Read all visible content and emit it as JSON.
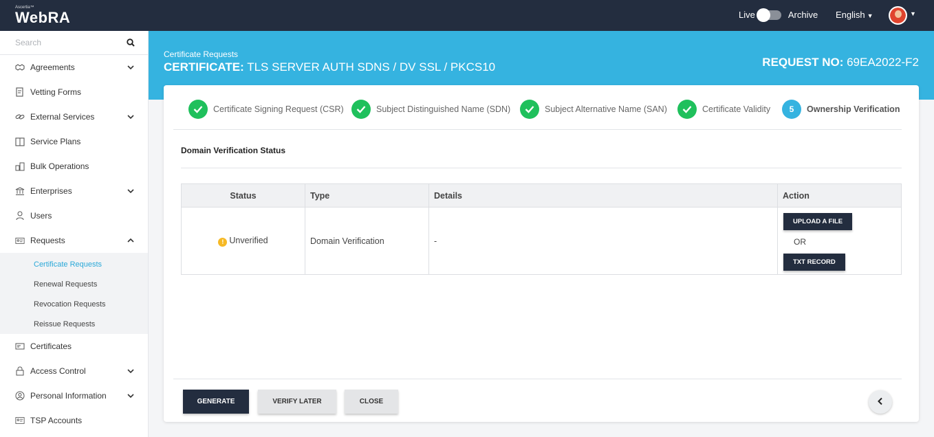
{
  "topbar": {
    "logo_small": "Ascertia™",
    "logo_main": "WebRA",
    "mode_live": "Live",
    "mode_archive": "Archive",
    "language": "English"
  },
  "sidebar": {
    "search_placeholder": "Search",
    "items": [
      {
        "label": "Agreements",
        "icon": "agreement-icon",
        "expandable": true
      },
      {
        "label": "Vetting Forms",
        "icon": "vetting-form-icon",
        "expandable": false
      },
      {
        "label": "External Services",
        "icon": "link-icon",
        "expandable": true
      },
      {
        "label": "Service Plans",
        "icon": "service-plan-icon",
        "expandable": false
      },
      {
        "label": "Bulk Operations",
        "icon": "bulk-icon",
        "expandable": false
      },
      {
        "label": "Enterprises",
        "icon": "bank-icon",
        "expandable": true
      },
      {
        "label": "Users",
        "icon": "user-icon",
        "expandable": false
      },
      {
        "label": "Requests",
        "icon": "requests-icon",
        "expandable": true,
        "expanded": true
      },
      {
        "label": "Certificates",
        "icon": "certificate-icon",
        "expandable": false
      },
      {
        "label": "Access Control",
        "icon": "lock-icon",
        "expandable": true
      },
      {
        "label": "Personal Information",
        "icon": "person-icon",
        "expandable": true
      },
      {
        "label": "TSP Accounts",
        "icon": "tsp-icon",
        "expandable": false
      }
    ],
    "requests_submenu": [
      {
        "label": "Certificate Requests",
        "active": true
      },
      {
        "label": "Renewal Requests",
        "active": false
      },
      {
        "label": "Revocation Requests",
        "active": false
      },
      {
        "label": "Reissue Requests",
        "active": false
      }
    ]
  },
  "header": {
    "breadcrumb": "Certificate Requests",
    "title_prefix": "CERTIFICATE:",
    "title_value": "TLS SERVER AUTH SDNS / DV SSL / PKCS10",
    "request_no_label": "REQUEST NO:",
    "request_no_value": "69EA2022-F2"
  },
  "steps": [
    {
      "label": "Certificate Signing Request (CSR)",
      "status": "done"
    },
    {
      "label": "Subject Distinguished Name (SDN)",
      "status": "done"
    },
    {
      "label": "Subject Alternative Name (SAN)",
      "status": "done"
    },
    {
      "label": "Certificate Validity",
      "status": "done"
    },
    {
      "label": "Ownership Verification",
      "status": "current",
      "number": "5"
    }
  ],
  "section": {
    "title": "Domain Verification Status"
  },
  "table": {
    "headers": [
      "Status",
      "Type",
      "Details",
      "Action"
    ],
    "row": {
      "status": "Unverified",
      "type": "Domain Verification",
      "details": "-",
      "action_upload": "UPLOAD A FILE",
      "action_or": "OR",
      "action_txt": "TXT RECORD"
    }
  },
  "footer": {
    "generate": "GENERATE",
    "verify_later": "VERIFY LATER",
    "close": "CLOSE"
  },
  "colors": {
    "topbar": "#232d3f",
    "accent": "#35b3e0",
    "success": "#1fc05c",
    "warning": "#f6b925"
  }
}
